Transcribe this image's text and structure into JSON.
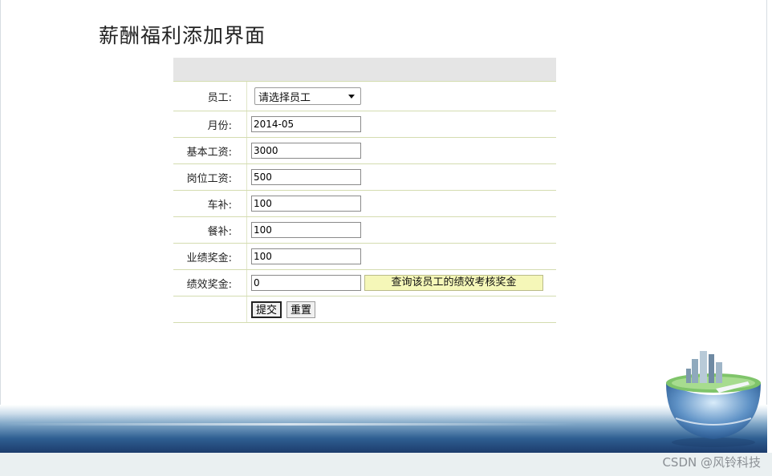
{
  "page": {
    "title": "薪酬福利添加界面",
    "watermark": "CSDN @风铃科技"
  },
  "form": {
    "employee": {
      "label": "员工:",
      "value": "请选择员工"
    },
    "month": {
      "label": "月份:",
      "value": "2014-05"
    },
    "base_salary": {
      "label": "基本工资:",
      "value": "3000"
    },
    "position_salary": {
      "label": "岗位工资:",
      "value": "500"
    },
    "car_allowance": {
      "label": "车补:",
      "value": "100"
    },
    "meal_allowance": {
      "label": "餐补:",
      "value": "100"
    },
    "performance_bonus": {
      "label": "业绩奖金:",
      "value": "100"
    },
    "merit_bonus": {
      "label": "绩效奖金:",
      "value": "0",
      "query_label": "查询该员工的绩效考核奖金"
    },
    "submit_label": "提交",
    "reset_label": "重置"
  },
  "colors": {
    "header_bg": "#e5e5e5",
    "row_border": "#d4dcb0",
    "query_button_bg": "#f5f7b8",
    "footer_blue": "#2f5f92"
  },
  "icons": {
    "dropdown": "chevron-down-icon",
    "decoration": "city-globe-icon"
  }
}
